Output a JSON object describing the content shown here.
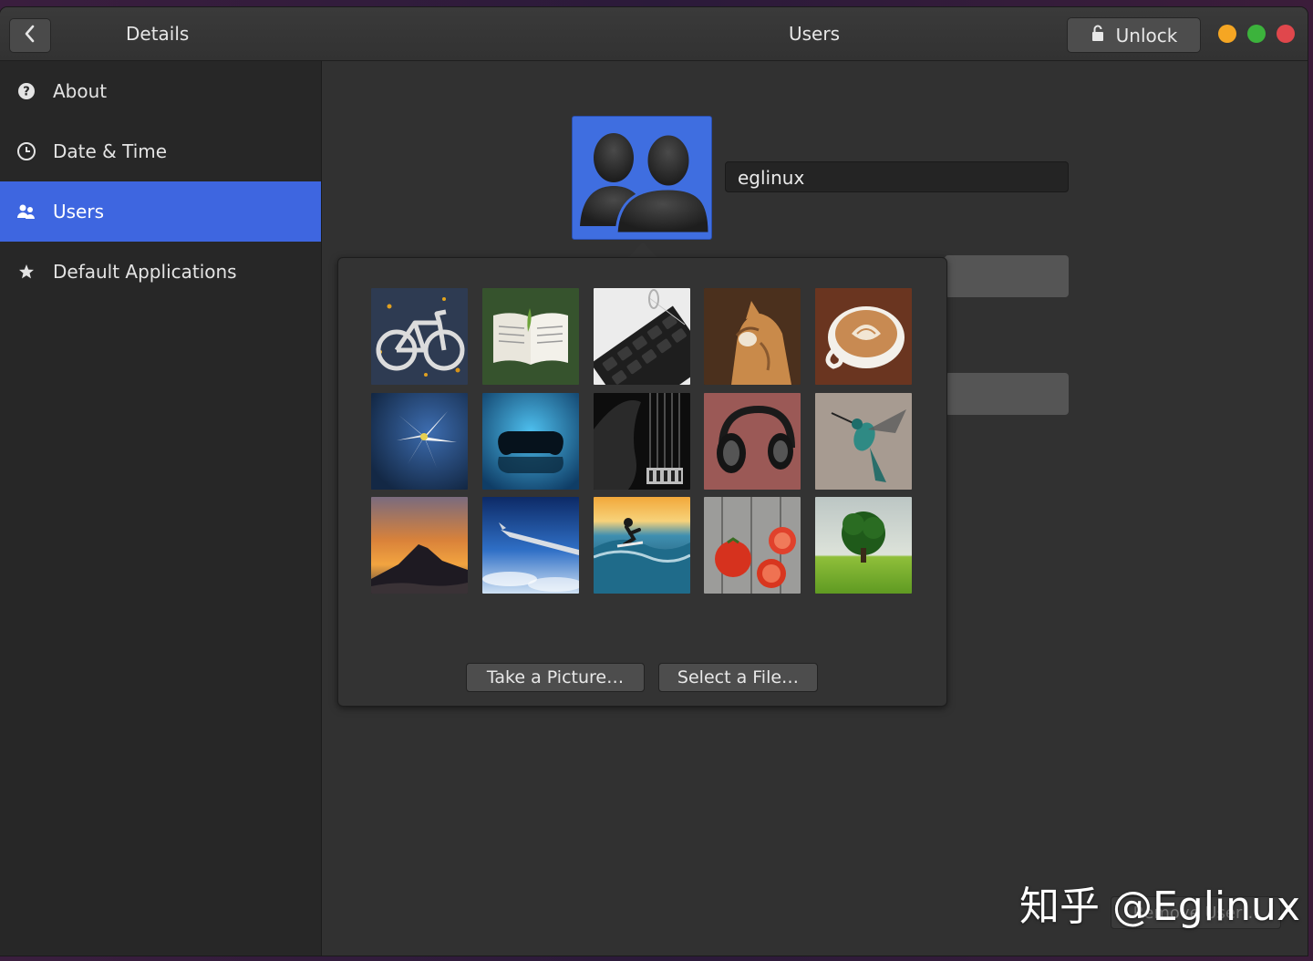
{
  "header": {
    "back_icon": "chevron-left-icon",
    "section_title": "Details",
    "panel_title": "Users",
    "unlock_label": "Unlock",
    "unlock_icon": "lock-icon",
    "window_controls": [
      "minimize",
      "maximize",
      "close"
    ]
  },
  "sidebar": {
    "items": [
      {
        "label": "About",
        "icon": "question-icon"
      },
      {
        "label": "Date & Time",
        "icon": "clock-icon"
      },
      {
        "label": "Users",
        "icon": "users-icon",
        "active": true
      },
      {
        "label": "Default Applications",
        "icon": "star-icon"
      }
    ]
  },
  "user": {
    "avatar": "default-users-avatar",
    "name": "eglinux"
  },
  "avatar_popover": {
    "pictures": [
      "bicycle",
      "book",
      "calculator",
      "cat",
      "coffee",
      "flower",
      "gamepad",
      "guitar",
      "headphones",
      "hummingbird",
      "mountain",
      "plane",
      "surfer",
      "tomatoes",
      "tree"
    ],
    "take_picture_label": "Take a Picture…",
    "select_file_label": "Select a File…"
  },
  "remove_user_label": "Remove User…",
  "watermark": "知乎 @Eglinux",
  "colors": {
    "accent": "#3e66e0",
    "minimize": "#f5a623",
    "maximize": "#3cb33c",
    "close": "#e0474c"
  }
}
